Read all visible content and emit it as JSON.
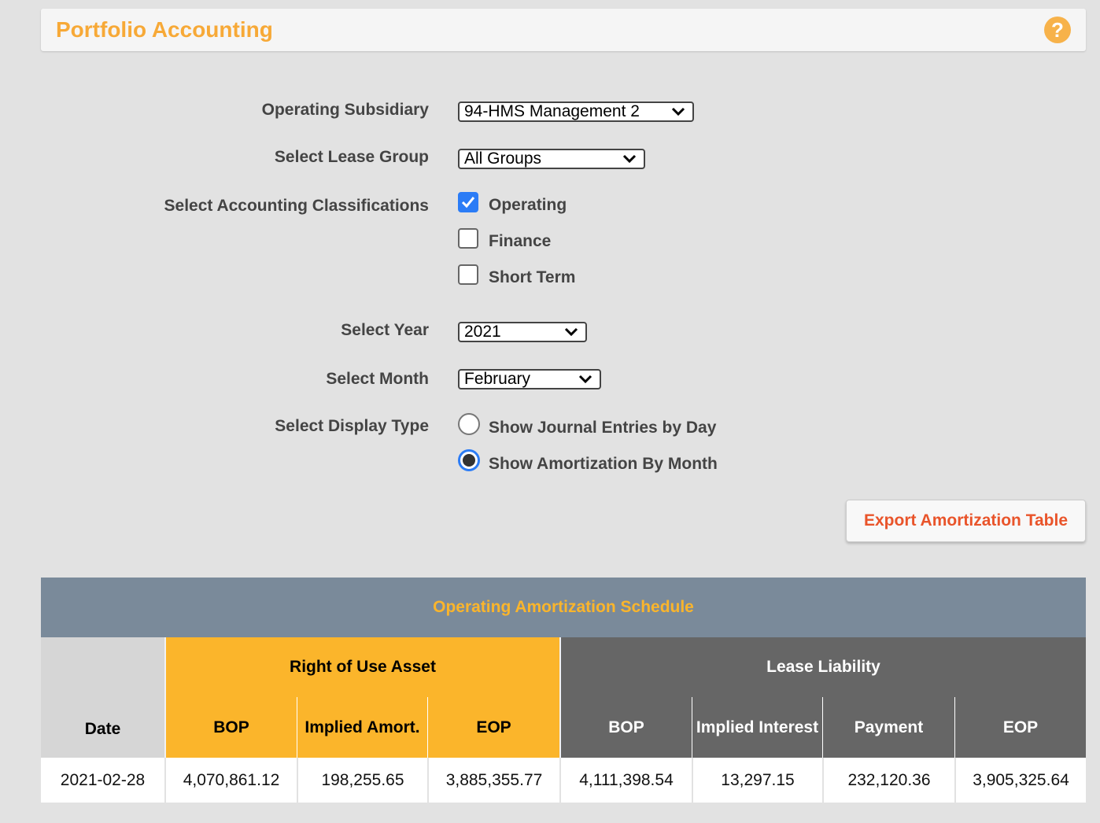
{
  "header": {
    "title": "Portfolio Accounting",
    "help_icon": "?"
  },
  "form": {
    "subsidiary": {
      "label": "Operating Subsidiary",
      "value": "94-HMS Management 2"
    },
    "lease_group": {
      "label": "Select Lease Group",
      "value": "All Groups"
    },
    "classifications": {
      "label": "Select Accounting Classifications",
      "options": [
        {
          "label": "Operating",
          "checked": true
        },
        {
          "label": "Finance",
          "checked": false
        },
        {
          "label": "Short Term",
          "checked": false
        }
      ]
    },
    "year": {
      "label": "Select Year",
      "value": "2021"
    },
    "month": {
      "label": "Select Month",
      "value": "February"
    },
    "display_type": {
      "label": "Select Display Type",
      "options": [
        {
          "label": "Show Journal Entries by Day",
          "selected": false
        },
        {
          "label": "Show Amortization By Month",
          "selected": true
        }
      ]
    }
  },
  "export_button": "Export Amortization Table",
  "schedule": {
    "title": "Operating Amortization Schedule",
    "date_header": "Date",
    "rou_group": "Right of Use Asset",
    "ll_group": "Lease Liability",
    "rou_columns": [
      "BOP",
      "Implied Amort.",
      "EOP"
    ],
    "ll_columns": [
      "BOP",
      "Implied Interest",
      "Payment",
      "EOP"
    ],
    "rows": [
      [
        "2021-02-28",
        "4,070,861.12",
        "198,255.65",
        "3,885,355.77",
        "4,111,398.54",
        "13,297.15",
        "232,120.36",
        "3,905,325.64"
      ]
    ]
  },
  "colors": {
    "accent_orange": "#f7a937",
    "rou_header": "#fbb52b",
    "ll_header": "#666666",
    "title_bar": "#7a8a9a",
    "export_text": "#e9542a",
    "check_blue": "#2b7cf6"
  }
}
